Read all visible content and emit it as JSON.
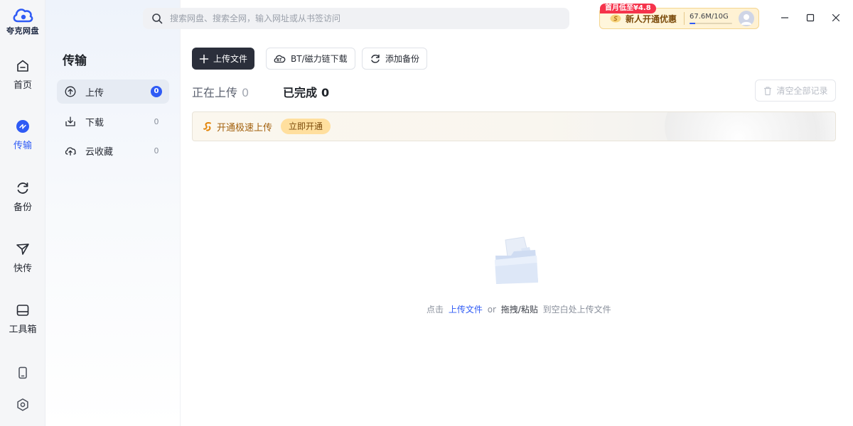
{
  "app": {
    "logo_text": "夸克网盘"
  },
  "rail": {
    "items": [
      {
        "id": "home",
        "label": "首页",
        "icon": "home-icon"
      },
      {
        "id": "transfer",
        "label": "传输",
        "icon": "transfer-icon",
        "active": true
      },
      {
        "id": "backup",
        "label": "备份",
        "icon": "backup-sync-icon"
      },
      {
        "id": "quick",
        "label": "快传",
        "icon": "paper-plane-icon"
      },
      {
        "id": "tools",
        "label": "工具箱",
        "icon": "toolbox-icon"
      }
    ],
    "bottom": [
      {
        "icon": "phone-icon"
      },
      {
        "icon": "settings-icon"
      }
    ]
  },
  "sidebar": {
    "title": "传输",
    "items": [
      {
        "label": "上传",
        "count": "0",
        "icon": "upload-icon",
        "active": true
      },
      {
        "label": "下载",
        "count": "0",
        "icon": "download-icon"
      },
      {
        "label": "云收藏",
        "count": "0",
        "icon": "cloud-save-icon"
      }
    ]
  },
  "search": {
    "placeholder": "搜索网盘、搜索全网，输入网址或从书签访问"
  },
  "promo": {
    "badge": "首月低至¥4.8",
    "text": "新人开通优惠",
    "storage": "67.6M/10G",
    "storage_used_fraction": 0.0066,
    "accent": "#f5334b"
  },
  "toolbar": {
    "upload_label": "上传文件",
    "bt_label": "BT/磁力链下载",
    "backup_label": "添加备份",
    "clear_label": "清空全部记录"
  },
  "tabs": [
    {
      "label": "正在上传",
      "count": "0",
      "active": false
    },
    {
      "label": "已完成",
      "count": "0",
      "active": true
    }
  ],
  "banner": {
    "text": "开通极速上传",
    "button": "立即开通"
  },
  "empty": {
    "prefix": "点击",
    "link": "上传文件",
    "or": "or",
    "drag": "拖拽/粘贴",
    "suffix": "到空白处上传文件"
  },
  "colors": {
    "brand": "#2f5bf5",
    "primary_button": "#2b2f3b",
    "banner_text": "#a2600c"
  }
}
